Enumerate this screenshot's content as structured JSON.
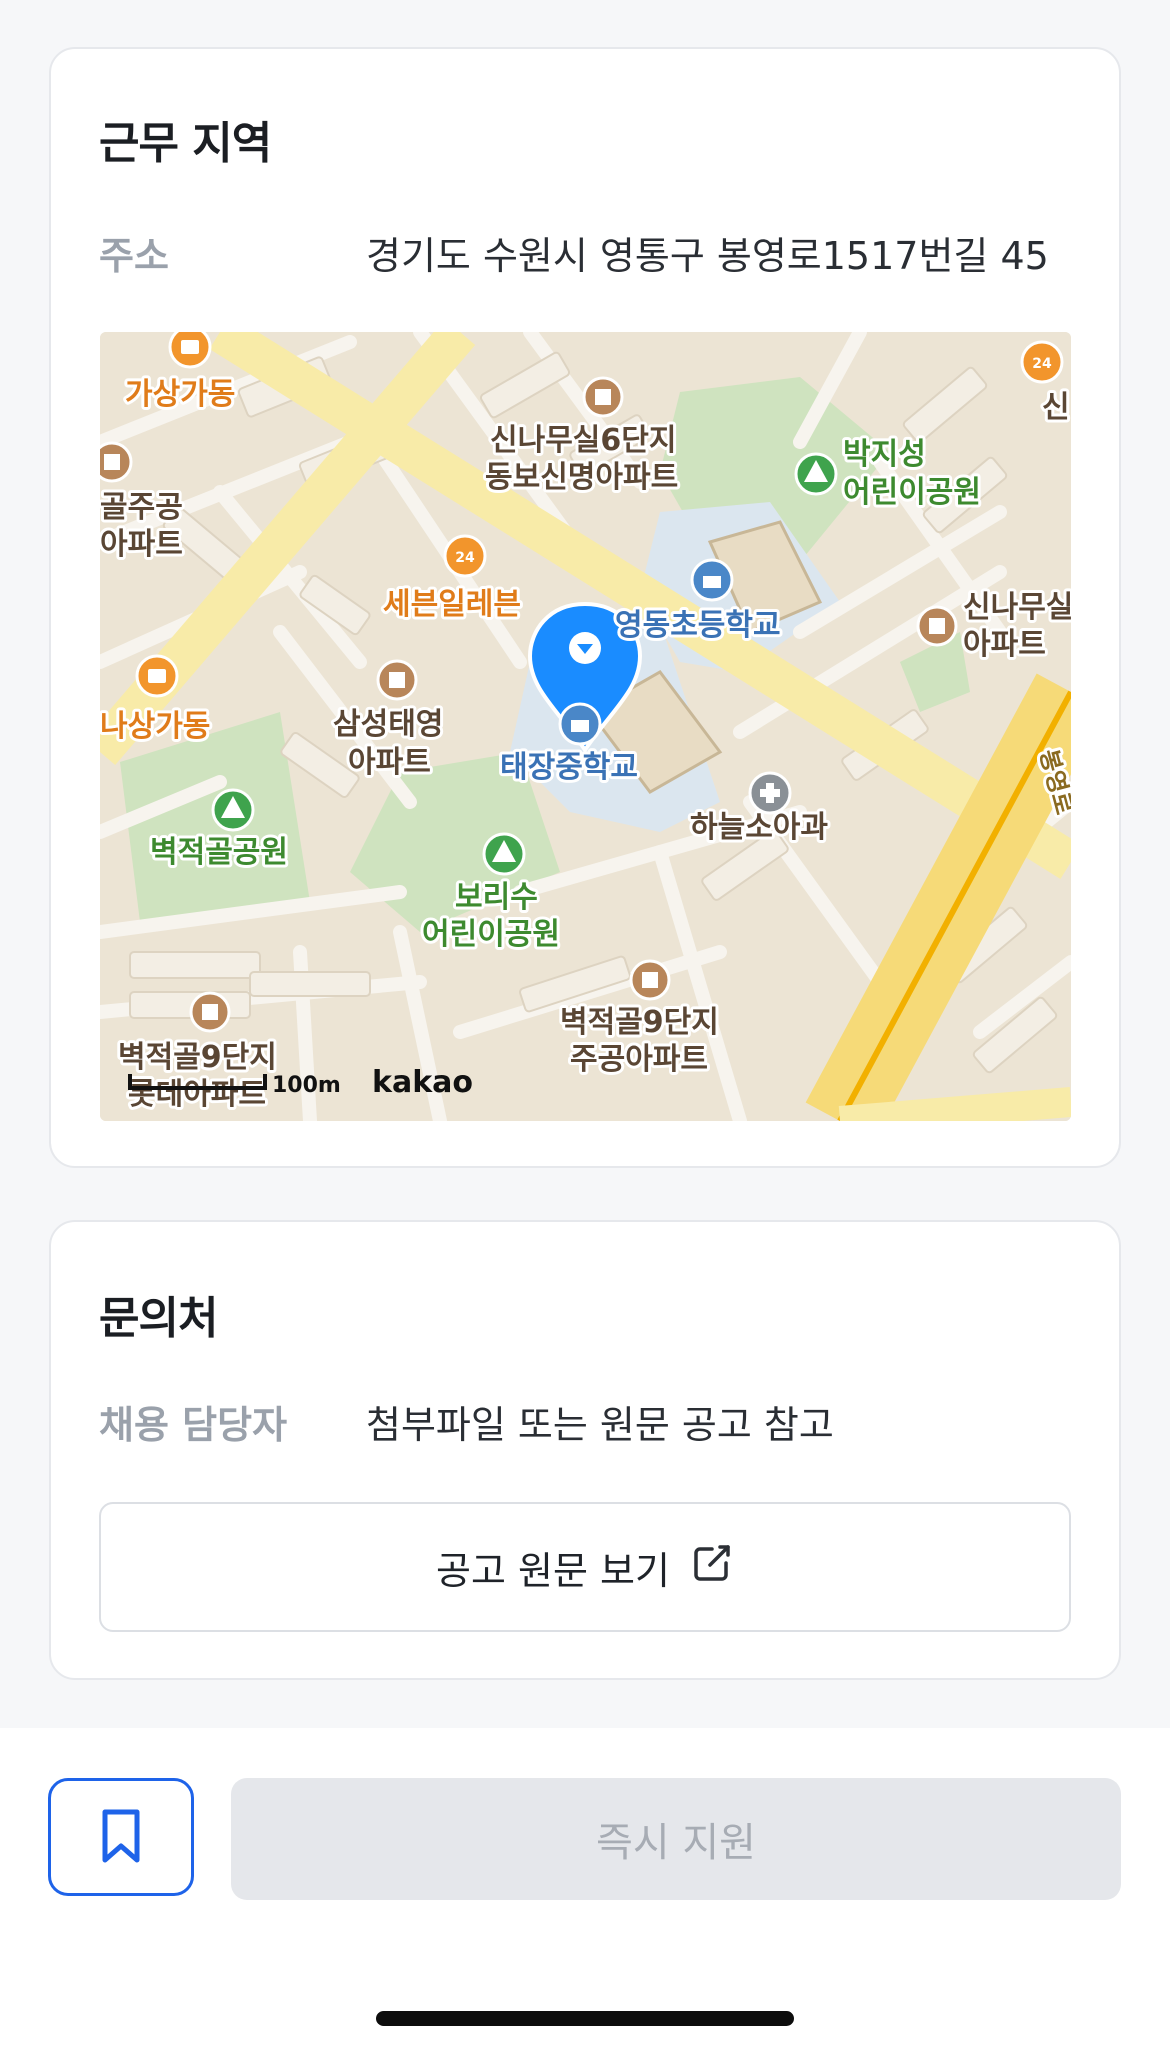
{
  "location": {
    "title": "근무 지역",
    "address_label": "주소",
    "address_value": "경기도 수원시 영통구 봉영로1517번길 45",
    "map": {
      "labels": {
        "l1": "가상가동",
        "l2": "신나무실6단지",
        "l3": "동보신명아파트",
        "l4": "박지성",
        "l5": "어린이공원",
        "l6": "신",
        "l7": "골주공",
        "l8": "아파트",
        "l9": "세븐일레븐",
        "l10": "영동초등학교",
        "l11": "신나무실",
        "l12": "아파트",
        "l13": "나상가동",
        "l14": "삼성태영",
        "l15": "아파트",
        "l16": "태장중학교",
        "l17": "하늘소아과",
        "l18": "벽적골공원",
        "l19": "보리수",
        "l20": "어린이공원",
        "l21": "벽적골9단지",
        "l22": "주공아파트",
        "l23": "벽적골9단지",
        "l24": "롯데아파트",
        "l25": "봉영로"
      },
      "scale_text": "100m",
      "provider": "kakao",
      "marker_color": "#1a8cff"
    }
  },
  "contact": {
    "title": "문의처",
    "recruiter_label": "채용 담당자",
    "recruiter_value": "첨부파일 또는 원문 공고 참고",
    "original_button_label": "공고 원문 보기"
  },
  "bottom": {
    "apply_label": "즉시 지원"
  },
  "colors": {
    "accent": "#1e63e9",
    "disabled_bg": "#e5e7eb",
    "disabled_text": "#a7acb4"
  },
  "icons": {
    "external_link": "external-link-icon",
    "bookmark": "bookmark-icon",
    "location_pin": "location-pin-icon"
  }
}
